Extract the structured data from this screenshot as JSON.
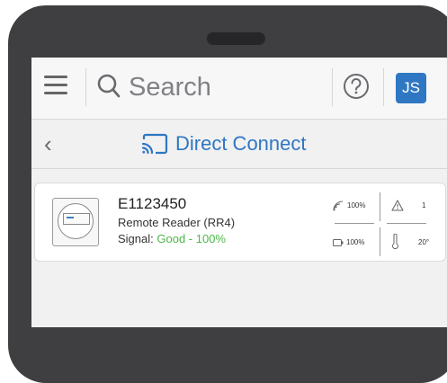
{
  "header": {
    "search_placeholder": "Search",
    "user_initials": "JS",
    "avatar_color": "#2f77c2"
  },
  "subheader": {
    "title": "Direct Connect",
    "title_color": "#2f77c2",
    "back_icon": "chevron-left-icon",
    "title_icon": "cast-icon"
  },
  "device": {
    "id": "E1123450",
    "model": "Remote Reader (RR4)",
    "signal_label": "Signal:",
    "signal_value": "Good - 100%",
    "signal_color": "#4bb848",
    "stats": {
      "wifi_strength": "100%",
      "alerts": "1",
      "battery": "100%",
      "temperature": "20°"
    }
  }
}
